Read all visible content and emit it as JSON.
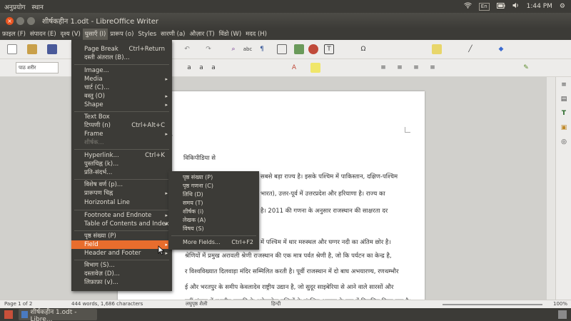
{
  "top_panel": {
    "menus": [
      "अनुप्रयोग",
      "स्थान"
    ],
    "keyboard": "En",
    "volume_icon": "volume-icon",
    "wifi_icon": "wifi-icon",
    "battery_icon": "battery-icon",
    "time": "1:44 PM"
  },
  "window": {
    "title": "शीर्षकहीन 1.odt - LibreOffice Writer"
  },
  "menu_bar": {
    "items": [
      "फ़ाइल (F)",
      "संपादन (E)",
      "दृश्य (V)",
      "घुसाएँ (I)",
      "प्रारूप (o)",
      "Styles",
      "सारणी (a)",
      "औज़ार (T)",
      "विंडो (W)",
      "मदद (H)"
    ],
    "active_index": 3
  },
  "toolbar": {
    "paragraph_style": "पाठ शरीर"
  },
  "insert_menu": {
    "items": [
      {
        "label": "Page Break",
        "shortcut": "Ctrl+Return"
      },
      {
        "label": "दस्ती अंतराल (B)..."
      },
      {
        "label": "Image..."
      },
      {
        "label": "Media",
        "submenu": true
      },
      {
        "label": "चार्ट (C)..."
      },
      {
        "label": "वस्तु (O)",
        "submenu": true
      },
      {
        "label": "Shape",
        "submenu": true
      },
      {
        "label": "Text Box"
      },
      {
        "label": "टिप्पणी (n)",
        "shortcut": "Ctrl+Alt+C"
      },
      {
        "label": "Frame",
        "submenu": true
      },
      {
        "label": "शीर्षक...",
        "disabled": true
      },
      {
        "label": "Hyperlink...",
        "shortcut": "Ctrl+K"
      },
      {
        "label": "पुस्तचिह्न (k)..."
      },
      {
        "label": "प्रति-संदर्भ..."
      },
      {
        "label": "विशेष वर्ण (p)..."
      },
      {
        "label": "प्रारूपण चिह्न",
        "submenu": true
      },
      {
        "label": "Horizontal Line"
      },
      {
        "label": "Footnote and Endnote",
        "submenu": true
      },
      {
        "label": "Table of Contents and Index",
        "submenu": true
      },
      {
        "label": "पृष्ठ संख्या (P)"
      },
      {
        "label": "Field",
        "submenu": true,
        "highlighted": true
      },
      {
        "label": "Header and Footer",
        "submenu": true
      },
      {
        "label": "विभाग (S)..."
      },
      {
        "label": "दस्तावेज़ (D)..."
      },
      {
        "label": "लिफ़ाफ़ा (v)..."
      }
    ]
  },
  "field_submenu": {
    "items": [
      {
        "label": "पृष्ठ संख्या (P)"
      },
      {
        "label": "पृष्ठ गणना (C)"
      },
      {
        "label": "तिथि (D)"
      },
      {
        "label": "समय (T)"
      },
      {
        "label": "शीर्षक (i)"
      },
      {
        "label": "लेखक (A)"
      },
      {
        "label": "विषय (S)"
      },
      {
        "label": "More Fields...",
        "shortcut": "Ctrl+F2"
      }
    ]
  },
  "document": {
    "heading": "न",
    "subtitle": "विकिपीडिया से",
    "lines": [
      "सबसे बड़ा राज्य है। इसके पश्चिम में पाकिस्तान, दक्षिण-पश्चिम",
      "भारत), उत्तर-पूर्व में उत्तरप्रदेश और हरियाणा है। राज्य का",
      "है। 2011 की गणना के अनुसार राजस्थान की साक्षरता दर",
      "में पश्चिम में थार मरुस्थल और घग्गर नदी का अंतिम छोर है।",
      "श्रेणियों में प्रमुख अरावली श्रेणी राजस्थान की एक मात्र पर्वत श्रेणी है, जो कि पर्यटन का केन्द्र है,",
      "र विश्वविख्यात दिलवाड़ा मंदिर सम्मिलित करती है। पूर्वी राजस्थान में दो बाघ अभयारण्य, रणथम्भौर",
      "ई और भरतपुर के समीप केवलादेव राष्ट्रीय उद्यान है, जो सुदूर साइबेरिया से आने वाले सारसों और",
      "नहीं संख्या में स्थानीय प्रजाति के अनेकानेक पक्षियों के संरक्षित-आवास के रूप में विकसित किया गया है।"
    ]
  },
  "status_bar": {
    "page": "Page 1 of 2",
    "words": "444 words, 1,686 characters",
    "style": "लघुपृष्ठ शैली",
    "language": "हिन्दी",
    "zoom": "100%"
  },
  "taskbar": {
    "item": "शीर्षकहीन 1.odt - Libre..."
  },
  "colors": {
    "highlight": "#e86d2d",
    "panel": "#3c3b37",
    "close_button": "#e95420"
  }
}
